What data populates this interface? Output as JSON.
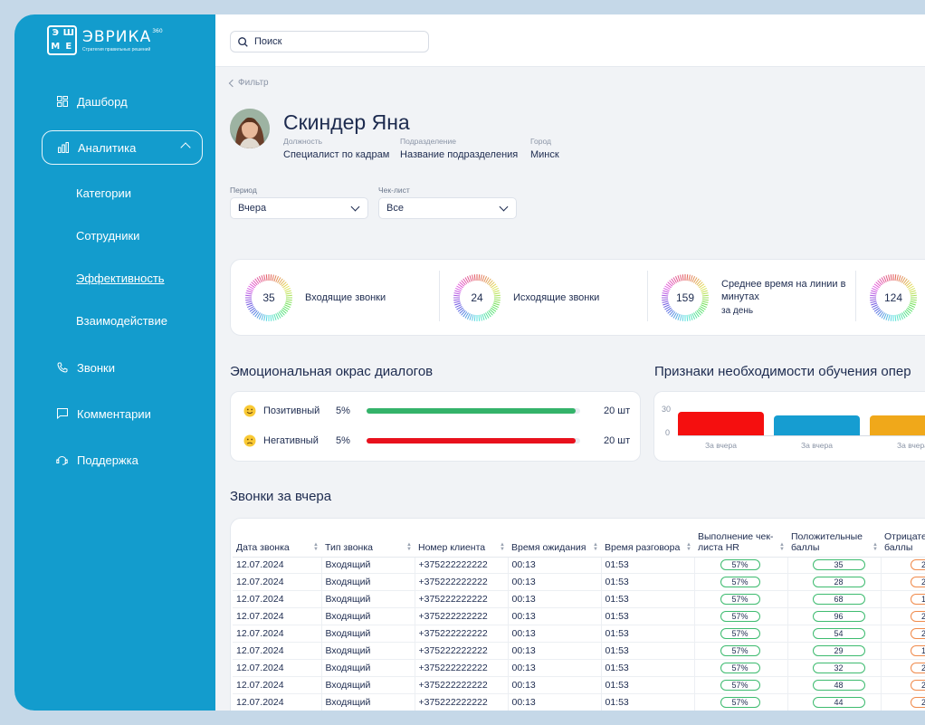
{
  "brand": {
    "name": "ЭВРИКА",
    "sup": "360",
    "tagline": "Стратегия правильных решений",
    "mark": [
      "Э",
      "Ш",
      "M",
      "E"
    ]
  },
  "search": {
    "placeholder": "Поиск"
  },
  "nav": {
    "items": [
      {
        "label": "Дашборд",
        "icon": "dashboard-icon"
      },
      {
        "label": "Аналитика",
        "icon": "analytics-icon",
        "active": true
      },
      {
        "label": "Звонки",
        "icon": "phone-icon"
      },
      {
        "label": "Комментарии",
        "icon": "comment-icon"
      },
      {
        "label": "Поддержка",
        "icon": "support-icon"
      }
    ],
    "subitems": [
      {
        "label": "Категории"
      },
      {
        "label": "Сотрудники"
      },
      {
        "label": "Эффективность",
        "current": true
      },
      {
        "label": "Взаимодействие"
      }
    ]
  },
  "back_label": "Фильтр",
  "profile": {
    "name": "Скиндер Яна",
    "fields": [
      {
        "label": "Должность",
        "value": "Специалист по кадрам"
      },
      {
        "label": "Подразделение",
        "value": "Название подразделения"
      },
      {
        "label": "Город",
        "value": "Минск"
      }
    ]
  },
  "filters": {
    "period": {
      "label": "Период",
      "value": "Вчера"
    },
    "checklist": {
      "label": "Чек-лист",
      "value": "Все"
    }
  },
  "kpis": [
    {
      "value": "35",
      "label": "Входящие звонки",
      "sub": ""
    },
    {
      "value": "24",
      "label": "Исходящие звонки",
      "sub": ""
    },
    {
      "value": "159",
      "label": "Среднее время на линии в минутах",
      "sub": "за день"
    },
    {
      "value": "124",
      "label": "",
      "sub": ""
    }
  ],
  "emotion": {
    "title": "Эмоциональная окрас диалогов",
    "rows": [
      {
        "name": "Позитивный",
        "pct": "5%",
        "count": "20 шт",
        "color": "#34b36a",
        "level": 0.98
      },
      {
        "name": "Негативный",
        "pct": "5%",
        "count": "20 шт",
        "color": "#e8111d",
        "level": 0.98
      }
    ]
  },
  "training": {
    "title": "Признаки необходимости обучения опер",
    "chart_data": {
      "type": "bar",
      "categories": [
        "За вчера",
        "За вчера",
        "За вчера"
      ],
      "values": [
        26,
        22,
        22
      ],
      "colors": [
        "#f50f0f",
        "#169dd1",
        "#f0a81a"
      ],
      "yticks": [
        "30",
        "0"
      ],
      "ylim": [
        0,
        30
      ]
    }
  },
  "calls": {
    "title": "Звонки за вчера",
    "columns": [
      "Дата звонка",
      "Тип звонка",
      "Номер клиента",
      "Время ожидания",
      "Время разговора",
      "Выполнение чек-листа HR",
      "Положительные баллы",
      "Отрицате баллы"
    ],
    "rows": [
      [
        "12.07.2024",
        "Входящий",
        "+375222222222",
        "00:13",
        "01:53",
        "57%",
        "35",
        "2"
      ],
      [
        "12.07.2024",
        "Входящий",
        "+375222222222",
        "00:13",
        "01:53",
        "57%",
        "28",
        "2"
      ],
      [
        "12.07.2024",
        "Входящий",
        "+375222222222",
        "00:13",
        "01:53",
        "57%",
        "68",
        "1"
      ],
      [
        "12.07.2024",
        "Входящий",
        "+375222222222",
        "00:13",
        "01:53",
        "57%",
        "96",
        "2"
      ],
      [
        "12.07.2024",
        "Входящий",
        "+375222222222",
        "00:13",
        "01:53",
        "57%",
        "54",
        "2"
      ],
      [
        "12.07.2024",
        "Входящий",
        "+375222222222",
        "00:13",
        "01:53",
        "57%",
        "29",
        "1"
      ],
      [
        "12.07.2024",
        "Входящий",
        "+375222222222",
        "00:13",
        "01:53",
        "57%",
        "32",
        "2"
      ],
      [
        "12.07.2024",
        "Входящий",
        "+375222222222",
        "00:13",
        "01:53",
        "57%",
        "48",
        "2"
      ],
      [
        "12.07.2024",
        "Входящий",
        "+375222222222",
        "00:13",
        "01:53",
        "57%",
        "44",
        "2"
      ]
    ]
  },
  "colors": {
    "sidebar": "#139ccd",
    "accent_green": "#34b36a",
    "accent_red": "#e8111d",
    "text": "#1d2b4f"
  }
}
